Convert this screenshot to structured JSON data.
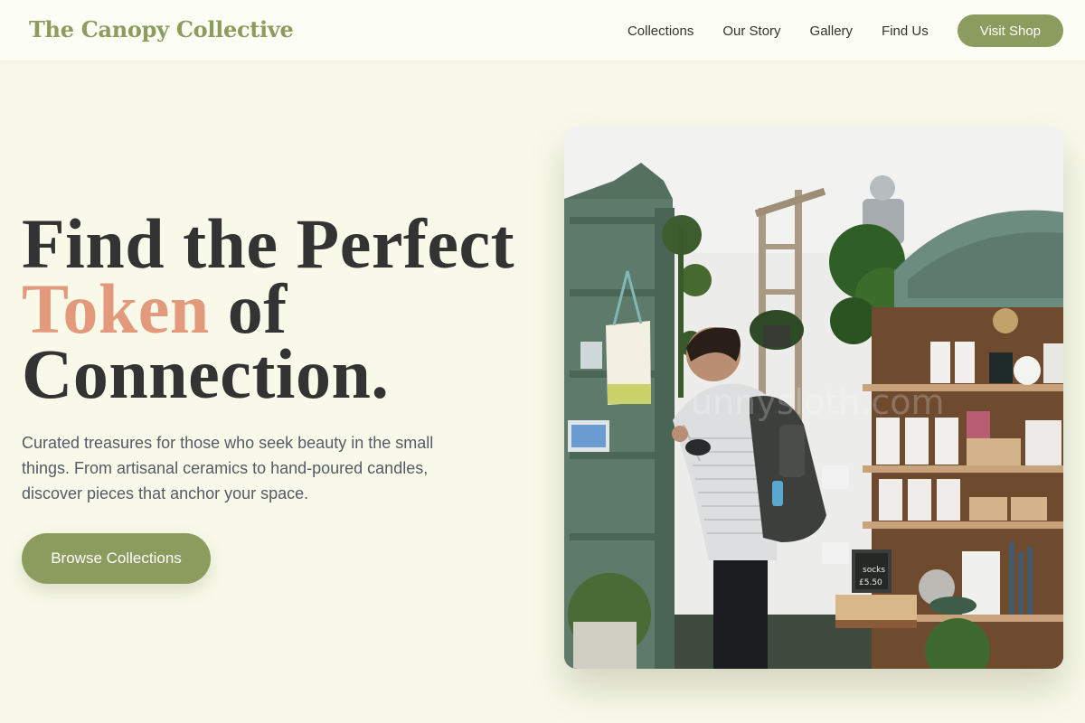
{
  "header": {
    "logo": "The Canopy Collective",
    "nav": [
      "Collections",
      "Our Story",
      "Gallery",
      "Find Us"
    ],
    "cta": "Visit Shop"
  },
  "hero": {
    "headline_line1": "Find the Perfect",
    "headline_accent": "Token",
    "headline_line2_rest": " of",
    "headline_line3": "Connection.",
    "description": "Curated treasures for those who seek beauty in the small things. From artisanal ceramics to hand-poured candles, discover pieces that anchor your space.",
    "button": "Browse Collections"
  },
  "image": {
    "watermark": "unnysloth.com",
    "sign_text": "socks £5.50"
  },
  "colors": {
    "brand": "#8c9b5e",
    "accent": "#e39a7c",
    "background": "#f8f9e9"
  }
}
